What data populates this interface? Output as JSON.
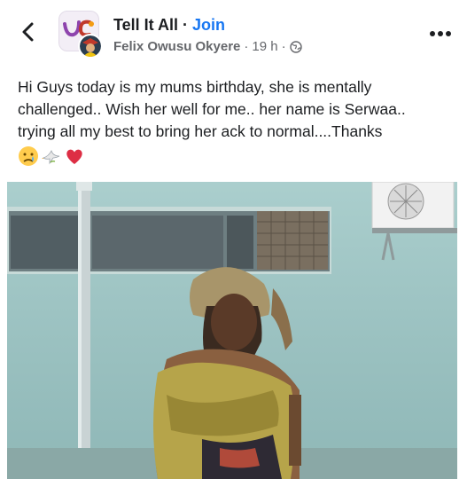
{
  "header": {
    "group_name": "Tell It All",
    "separator": "·",
    "join_label": "Join",
    "author": "Felix Owusu Okyere",
    "meta_sep": "·",
    "time": "19 h",
    "meta_sep2": "·",
    "back_icon": "chevron-left-icon",
    "privacy_icon": "globe-icon",
    "more_icon": "more-dots-icon"
  },
  "post": {
    "line1": "Hi Guys today is my mums birthday, she is mentally",
    "line2": "challenged.. Wish her well for me.. her name is Serwaa..",
    "line3": "trying all my best to bring her  ack to normal....Thanks",
    "emojis": [
      "sad-but-relieved-face-emoji",
      "dove-emoji",
      "red-heart-emoji"
    ]
  },
  "colors": {
    "link": "#1877f2",
    "meta": "#65676b",
    "text": "#1c1e21"
  }
}
